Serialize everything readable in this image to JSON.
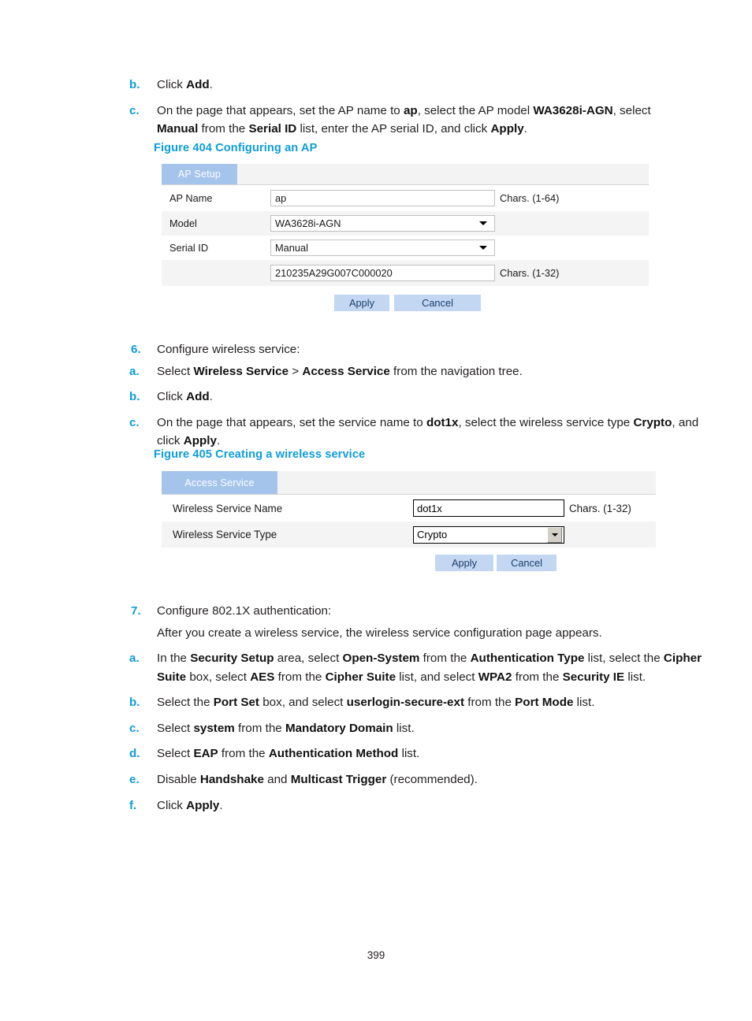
{
  "page": {
    "number": "399"
  },
  "block_a": {
    "items": [
      {
        "marker": "b.",
        "parts": [
          {
            "t": "Click ",
            "b": false
          },
          {
            "t": "Add",
            "b": true
          },
          {
            "t": ".",
            "b": false
          }
        ]
      },
      {
        "marker": "c.",
        "parts": [
          {
            "t": "On the page that appears, set the AP name to ",
            "b": false
          },
          {
            "t": "ap",
            "b": true
          },
          {
            "t": ", select the AP model ",
            "b": false
          },
          {
            "t": "WA3628i-AGN",
            "b": true
          },
          {
            "t": ", select ",
            "b": false
          },
          {
            "t": "Manual",
            "b": true
          },
          {
            "t": " from the ",
            "b": false
          },
          {
            "t": "Serial ID",
            "b": true
          },
          {
            "t": " list, enter the AP serial ID, and click ",
            "b": false
          },
          {
            "t": "Apply",
            "b": true
          },
          {
            "t": ".",
            "b": false
          }
        ]
      }
    ]
  },
  "figure404": {
    "caption": "Figure 404 Configuring an AP",
    "tab_label": "AP Setup",
    "rows": [
      {
        "label": "AP Name",
        "control": "text",
        "value": "ap",
        "hint": "Chars. (1-64)"
      },
      {
        "label": "Model",
        "control": "select",
        "value": "WA3628i-AGN",
        "hint": ""
      },
      {
        "label": "Serial ID",
        "control": "select",
        "value": "Manual",
        "hint": ""
      },
      {
        "label": "",
        "control": "text",
        "value": "210235A29G007C000020",
        "hint": "Chars. (1-32)"
      }
    ],
    "apply_label": "Apply",
    "cancel_label": "Cancel"
  },
  "block_b": {
    "step": {
      "marker": "6.",
      "text": "Configure wireless service:"
    },
    "items": [
      {
        "marker": "a.",
        "parts": [
          {
            "t": "Select ",
            "b": false
          },
          {
            "t": "Wireless Service",
            "b": true
          },
          {
            "t": " > ",
            "b": false
          },
          {
            "t": "Access Service",
            "b": true
          },
          {
            "t": " from the navigation tree.",
            "b": false
          }
        ]
      },
      {
        "marker": "b.",
        "parts": [
          {
            "t": "Click ",
            "b": false
          },
          {
            "t": "Add",
            "b": true
          },
          {
            "t": ".",
            "b": false
          }
        ]
      },
      {
        "marker": "c.",
        "parts": [
          {
            "t": "On the page that appears, set the service name to ",
            "b": false
          },
          {
            "t": "dot1x",
            "b": true
          },
          {
            "t": ", select the wireless service type ",
            "b": false
          },
          {
            "t": "Crypto",
            "b": true
          },
          {
            "t": ", and click ",
            "b": false
          },
          {
            "t": "Apply",
            "b": true
          },
          {
            "t": ".",
            "b": false
          }
        ]
      }
    ]
  },
  "figure405": {
    "caption": "Figure 405 Creating a wireless service",
    "tab_label": "Access Service",
    "rows": [
      {
        "label": "Wireless Service Name",
        "control": "text",
        "value": "dot1x",
        "hint": "Chars. (1-32)"
      },
      {
        "label": "Wireless Service Type",
        "control": "select",
        "value": "Crypto",
        "hint": ""
      }
    ],
    "apply_label": "Apply",
    "cancel_label": "Cancel"
  },
  "block_c": {
    "step": {
      "marker": "7.",
      "text": "Configure 802.1X authentication:"
    },
    "intro": "After you create a wireless service, the wireless service configuration page appears.",
    "items": [
      {
        "marker": "a.",
        "parts": [
          {
            "t": "In the ",
            "b": false
          },
          {
            "t": "Security Setup",
            "b": true
          },
          {
            "t": " area, select ",
            "b": false
          },
          {
            "t": "Open-System",
            "b": true
          },
          {
            "t": " from the ",
            "b": false
          },
          {
            "t": "Authentication Type",
            "b": true
          },
          {
            "t": " list, select the ",
            "b": false
          },
          {
            "t": "Cipher Suite",
            "b": true
          },
          {
            "t": " box, select ",
            "b": false
          },
          {
            "t": "AES",
            "b": true
          },
          {
            "t": " from the ",
            "b": false
          },
          {
            "t": "Cipher Suite",
            "b": true
          },
          {
            "t": " list, and select ",
            "b": false
          },
          {
            "t": "WPA2",
            "b": true
          },
          {
            "t": " from the ",
            "b": false
          },
          {
            "t": "Security IE",
            "b": true
          },
          {
            "t": " list.",
            "b": false
          }
        ]
      },
      {
        "marker": "b.",
        "parts": [
          {
            "t": "Select the ",
            "b": false
          },
          {
            "t": "Port Set",
            "b": true
          },
          {
            "t": " box, and select ",
            "b": false
          },
          {
            "t": "userlogin-secure-ext",
            "b": true
          },
          {
            "t": " from the ",
            "b": false
          },
          {
            "t": "Port Mode",
            "b": true
          },
          {
            "t": " list.",
            "b": false
          }
        ]
      },
      {
        "marker": "c.",
        "parts": [
          {
            "t": "Select ",
            "b": false
          },
          {
            "t": "system",
            "b": true
          },
          {
            "t": " from the ",
            "b": false
          },
          {
            "t": "Mandatory Domain",
            "b": true
          },
          {
            "t": " list.",
            "b": false
          }
        ]
      },
      {
        "marker": "d.",
        "parts": [
          {
            "t": "Select ",
            "b": false
          },
          {
            "t": "EAP",
            "b": true
          },
          {
            "t": " from the ",
            "b": false
          },
          {
            "t": "Authentication Method",
            "b": true
          },
          {
            "t": " list.",
            "b": false
          }
        ]
      },
      {
        "marker": "e.",
        "parts": [
          {
            "t": "Disable ",
            "b": false
          },
          {
            "t": "Handshake",
            "b": true
          },
          {
            "t": " and ",
            "b": false
          },
          {
            "t": "Multicast Trigger",
            "b": true
          },
          {
            "t": " (recommended).",
            "b": false
          }
        ]
      },
      {
        "marker": "f.",
        "parts": [
          {
            "t": "Click ",
            "b": false
          },
          {
            "t": "Apply",
            "b": true
          },
          {
            "t": ".",
            "b": false
          }
        ]
      }
    ]
  },
  "colors": {
    "accent": "#0e9dd9",
    "tab_bg": "#a5c4ec",
    "button_bg": "#c4d7f2",
    "row_alt_bg": "#f4f4f4",
    "text": "#231f20"
  }
}
